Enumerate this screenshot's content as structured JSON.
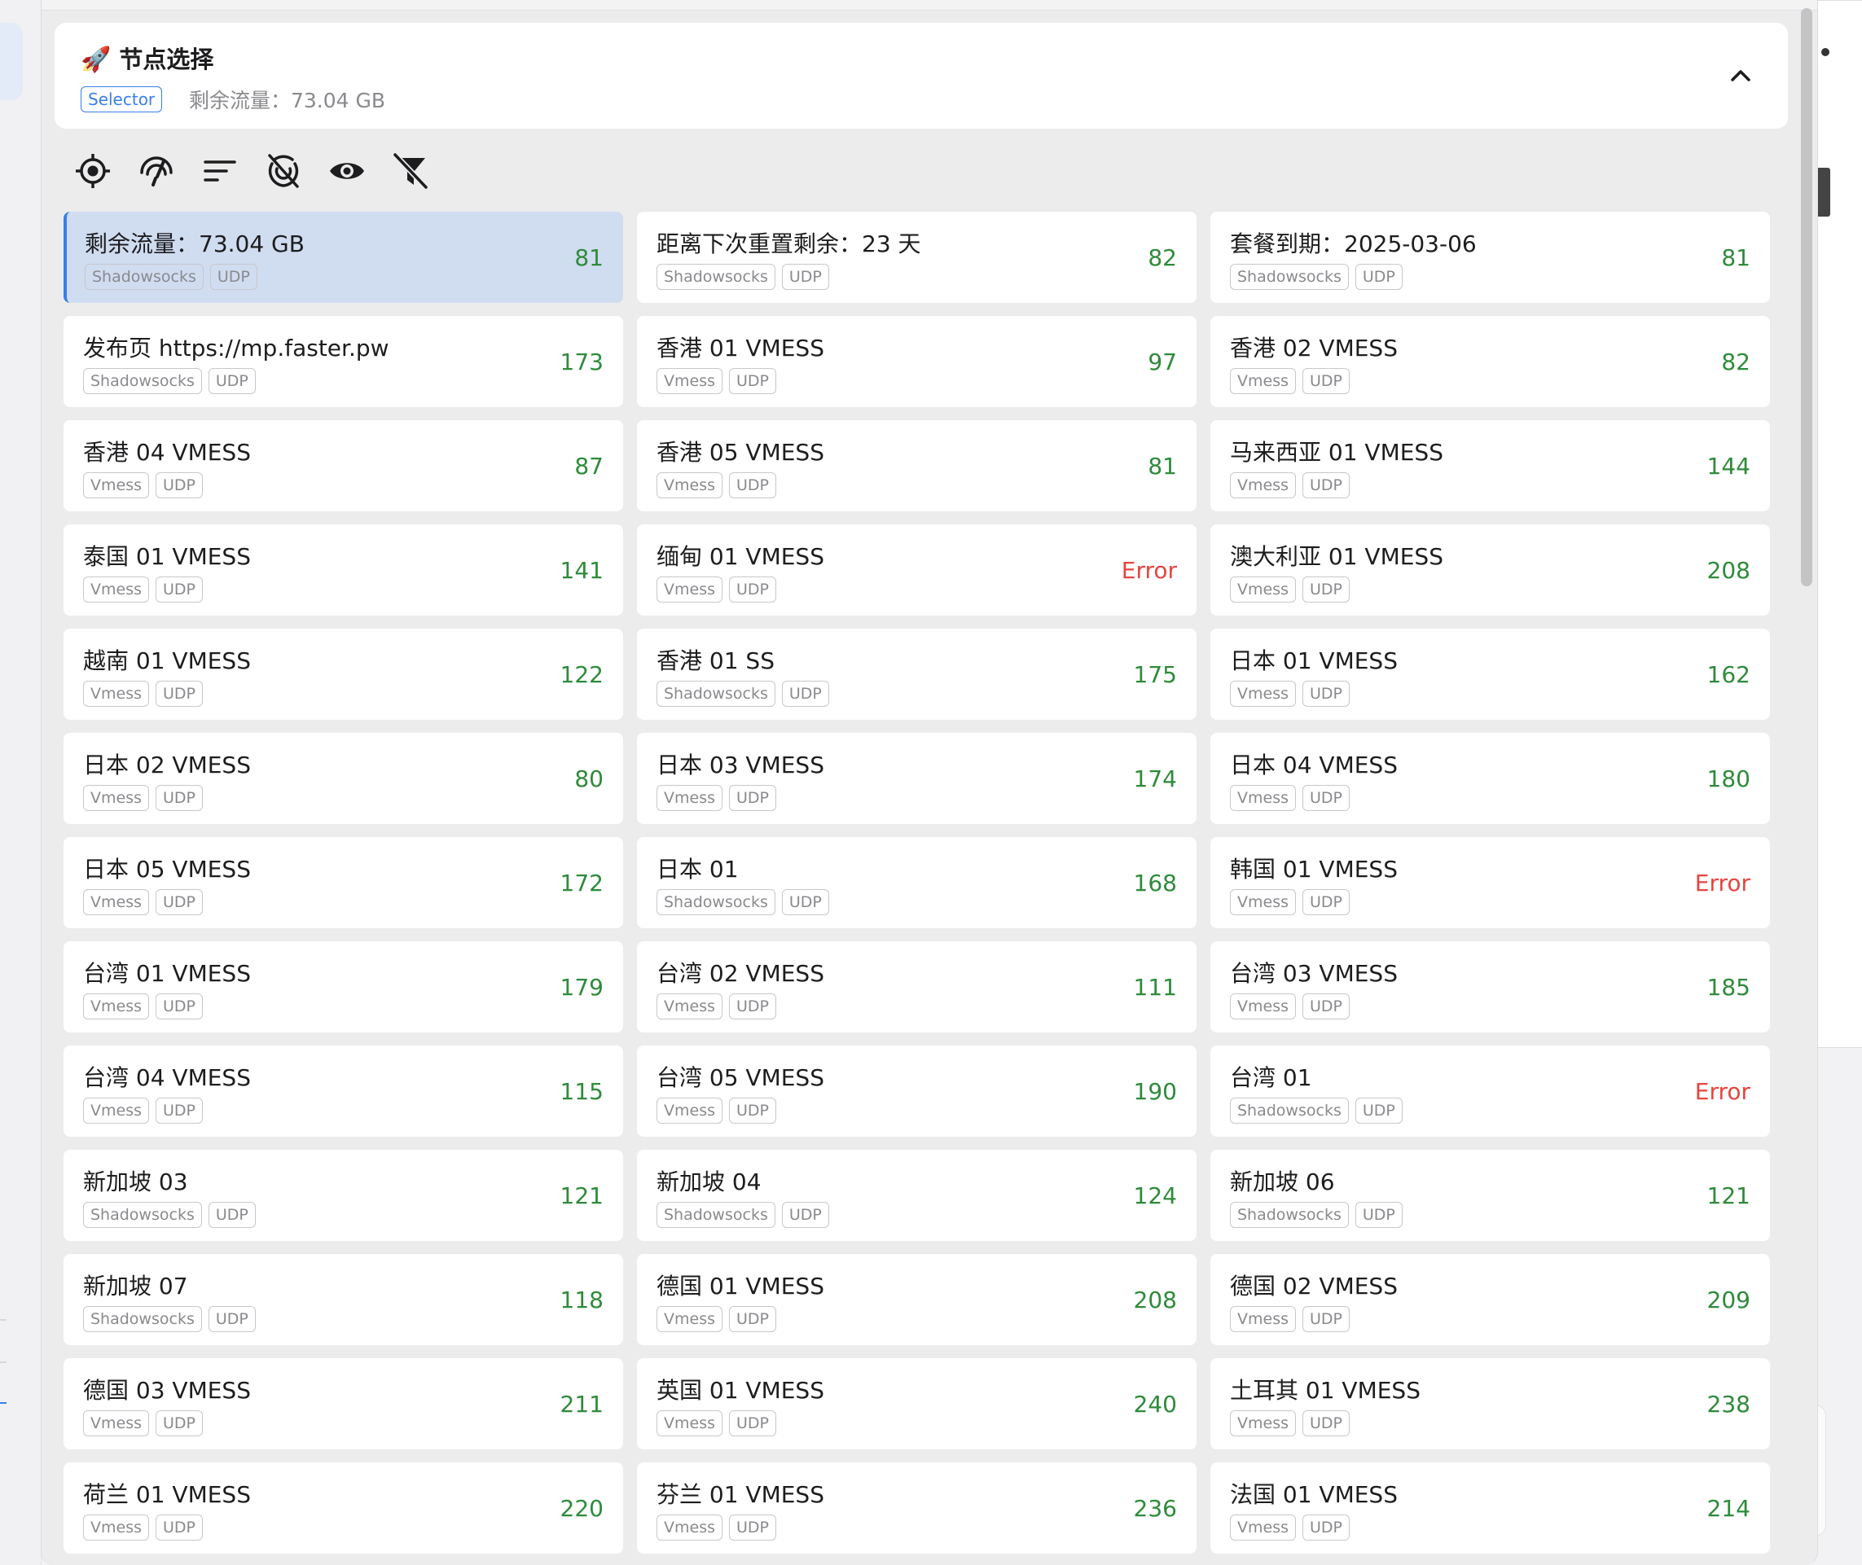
{
  "group": {
    "icon": "🚀",
    "title": "节点选择",
    "type_badge": "Selector",
    "subtitle": "剩余流量：73.04 GB"
  },
  "toolbar": [
    {
      "name": "locate-icon"
    },
    {
      "name": "delay-test-icon"
    },
    {
      "name": "sort-icon"
    },
    {
      "name": "hide-unavailable-icon"
    },
    {
      "name": "show-icon"
    },
    {
      "name": "filter-off-icon"
    }
  ],
  "colors": {
    "accent": "#3a7ee8",
    "ok": "#2e8b3a",
    "error": "#e5453f"
  },
  "proxies": [
    {
      "name": "剩余流量：73.04 GB",
      "type": "Shadowsocks",
      "udp": "UDP",
      "delay": "81",
      "selected": true
    },
    {
      "name": "距离下次重置剩余：23 天",
      "type": "Shadowsocks",
      "udp": "UDP",
      "delay": "82"
    },
    {
      "name": "套餐到期：2025-03-06",
      "type": "Shadowsocks",
      "udp": "UDP",
      "delay": "81"
    },
    {
      "name": "发布页 https://mp.faster.pw",
      "type": "Shadowsocks",
      "udp": "UDP",
      "delay": "173"
    },
    {
      "name": "香港 01 VMESS",
      "type": "Vmess",
      "udp": "UDP",
      "delay": "97"
    },
    {
      "name": "香港 02 VMESS",
      "type": "Vmess",
      "udp": "UDP",
      "delay": "82"
    },
    {
      "name": "香港 04 VMESS",
      "type": "Vmess",
      "udp": "UDP",
      "delay": "87"
    },
    {
      "name": "香港 05 VMESS",
      "type": "Vmess",
      "udp": "UDP",
      "delay": "81"
    },
    {
      "name": "马来西亚 01 VMESS",
      "type": "Vmess",
      "udp": "UDP",
      "delay": "144"
    },
    {
      "name": "泰国 01 VMESS",
      "type": "Vmess",
      "udp": "UDP",
      "delay": "141"
    },
    {
      "name": "缅甸 01 VMESS",
      "type": "Vmess",
      "udp": "UDP",
      "delay": "Error"
    },
    {
      "name": "澳大利亚 01 VMESS",
      "type": "Vmess",
      "udp": "UDP",
      "delay": "208"
    },
    {
      "name": "越南 01 VMESS",
      "type": "Vmess",
      "udp": "UDP",
      "delay": "122"
    },
    {
      "name": "香港 01 SS",
      "type": "Shadowsocks",
      "udp": "UDP",
      "delay": "175"
    },
    {
      "name": "日本 01 VMESS",
      "type": "Vmess",
      "udp": "UDP",
      "delay": "162"
    },
    {
      "name": "日本 02 VMESS",
      "type": "Vmess",
      "udp": "UDP",
      "delay": "80"
    },
    {
      "name": "日本 03 VMESS",
      "type": "Vmess",
      "udp": "UDP",
      "delay": "174"
    },
    {
      "name": "日本 04 VMESS",
      "type": "Vmess",
      "udp": "UDP",
      "delay": "180"
    },
    {
      "name": "日本 05 VMESS",
      "type": "Vmess",
      "udp": "UDP",
      "delay": "172"
    },
    {
      "name": "日本 01",
      "type": "Shadowsocks",
      "udp": "UDP",
      "delay": "168"
    },
    {
      "name": "韩国 01 VMESS",
      "type": "Vmess",
      "udp": "UDP",
      "delay": "Error"
    },
    {
      "name": "台湾 01 VMESS",
      "type": "Vmess",
      "udp": "UDP",
      "delay": "179"
    },
    {
      "name": "台湾 02 VMESS",
      "type": "Vmess",
      "udp": "UDP",
      "delay": "111"
    },
    {
      "name": "台湾 03 VMESS",
      "type": "Vmess",
      "udp": "UDP",
      "delay": "185"
    },
    {
      "name": "台湾 04 VMESS",
      "type": "Vmess",
      "udp": "UDP",
      "delay": "115"
    },
    {
      "name": "台湾 05 VMESS",
      "type": "Vmess",
      "udp": "UDP",
      "delay": "190"
    },
    {
      "name": "台湾 01",
      "type": "Shadowsocks",
      "udp": "UDP",
      "delay": "Error"
    },
    {
      "name": "新加坡 03",
      "type": "Shadowsocks",
      "udp": "UDP",
      "delay": "121"
    },
    {
      "name": "新加坡 04",
      "type": "Shadowsocks",
      "udp": "UDP",
      "delay": "124"
    },
    {
      "name": "新加坡 06",
      "type": "Shadowsocks",
      "udp": "UDP",
      "delay": "121"
    },
    {
      "name": "新加坡 07",
      "type": "Shadowsocks",
      "udp": "UDP",
      "delay": "118"
    },
    {
      "name": "德国 01 VMESS",
      "type": "Vmess",
      "udp": "UDP",
      "delay": "208"
    },
    {
      "name": "德国 02 VMESS",
      "type": "Vmess",
      "udp": "UDP",
      "delay": "209"
    },
    {
      "name": "德国 03 VMESS",
      "type": "Vmess",
      "udp": "UDP",
      "delay": "211"
    },
    {
      "name": "英国 01 VMESS",
      "type": "Vmess",
      "udp": "UDP",
      "delay": "240"
    },
    {
      "name": "土耳其 01 VMESS",
      "type": "Vmess",
      "udp": "UDP",
      "delay": "238"
    },
    {
      "name": "荷兰 01 VMESS",
      "type": "Vmess",
      "udp": "UDP",
      "delay": "220"
    },
    {
      "name": "芬兰 01 VMESS",
      "type": "Vmess",
      "udp": "UDP",
      "delay": "236"
    },
    {
      "name": "法国 01 VMESS",
      "type": "Vmess",
      "udp": "UDP",
      "delay": "214"
    }
  ]
}
